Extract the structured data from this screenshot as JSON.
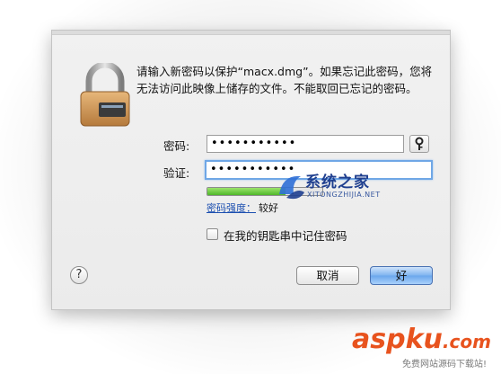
{
  "dialog": {
    "message": "请输入新密码以保护“macx.dmg”。如果忘记此密码，您将无法访问此映像上储存的文件。不能取回已忘记的密码。",
    "password_label": "密码:",
    "password_value": "•••••••••••",
    "verify_label": "验证:",
    "verify_value": "•••••••••••",
    "strength_link": "密码强度：",
    "strength_value": "较好",
    "strength_level": 0.68,
    "remember_label": "在我的钥匙串中记住密码",
    "remember_checked": false,
    "help_label": "?",
    "cancel_label": "取消",
    "ok_label": "好"
  },
  "watermarks": {
    "system_home": "系统之家",
    "system_home_sub": "XITONGZHIJIA.NET",
    "aspku": "aspku",
    "aspku_sub": ".com",
    "aspku_tagline": "免费网站源码下载站!"
  },
  "colors": {
    "accent": "#6aa6ec",
    "meter_green": "#4fb62a",
    "aspku_orange": "#e8531e"
  }
}
